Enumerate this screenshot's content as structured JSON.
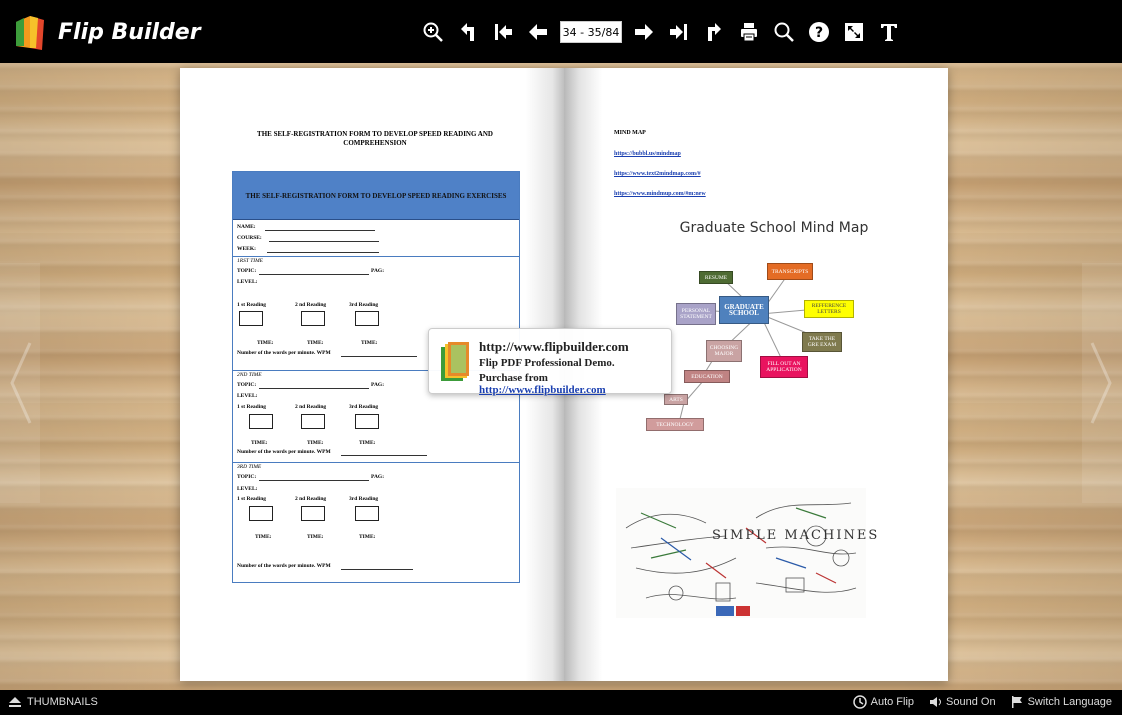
{
  "app": {
    "title": "Flip Builder"
  },
  "toolbar": {
    "page_indicator": "34 - 35/84",
    "tools": [
      "zoom-in-icon",
      "back-icon",
      "first-page-icon",
      "prev-page-icon",
      "next-page-icon",
      "last-page-icon",
      "share-icon",
      "print-icon",
      "search-icon",
      "help-icon",
      "fullscreen-icon",
      "text-icon"
    ]
  },
  "left_page": {
    "title_line1": "THE SELF-REGISTRATION FORM TO DEVELOP SPEED READING AND",
    "title_line2": "COMPREHENSION",
    "form_header": "THE SELF-REGISTRATION FORM TO DEVELOP SPEED READING EXERCISES",
    "name": "NAME:",
    "course": "COURSE:",
    "week": "WEEK:",
    "first_time": "1RST TIME",
    "second_time": "2ND TIME",
    "third_time": "3RD TIME",
    "topic": "TOPIC:",
    "pag": "PAG:",
    "level": "LEVEL:",
    "reading1": "1 st Reading",
    "reading2": "2 nd Reading",
    "reading3": "3rd Reading",
    "time": "TIME:",
    "wpm": "Number of the words per minute. WPM"
  },
  "right_page": {
    "heading": "MIND MAP",
    "link1": "https://bubbl.us/mindmap",
    "link2": "https://www.text2mindmap.com/#",
    "link3": "https://www.mindmup.com/#m:new",
    "mindmap_title": "Graduate School Mind Map",
    "nodes": {
      "center": "GRADUATE SCHOOL",
      "resume": "RESUME",
      "transcripts": "TRANSCRIPTS",
      "references": "REFFERENCE LETTERS",
      "personal": "PERSONAL STATEMENT",
      "greexam": "TAKE THE GRE EXAM",
      "major": "CHOOSING MAJOR",
      "application": "FILL OUT AN APPLICATION",
      "education": "EDUCATION",
      "arts": "ARTS",
      "technology": "TECHNOLOGY"
    },
    "sketch_label": "SIMPLE MACHINES"
  },
  "watermark": {
    "url": "http://www.flipbuilder.com",
    "line2": "Flip PDF Professional Demo.",
    "line3_prefix": "Purchase from ",
    "line3_link": "http://www.flipbuilder.com"
  },
  "bottom": {
    "thumbnails": "THUMBNAILS",
    "auto_flip": "Auto Flip",
    "sound": "Sound On",
    "language": "Switch Language"
  },
  "colors": {
    "toolbar_bg": "#000000",
    "link": "#1a3fb0",
    "form_header": "#4f81c7"
  }
}
